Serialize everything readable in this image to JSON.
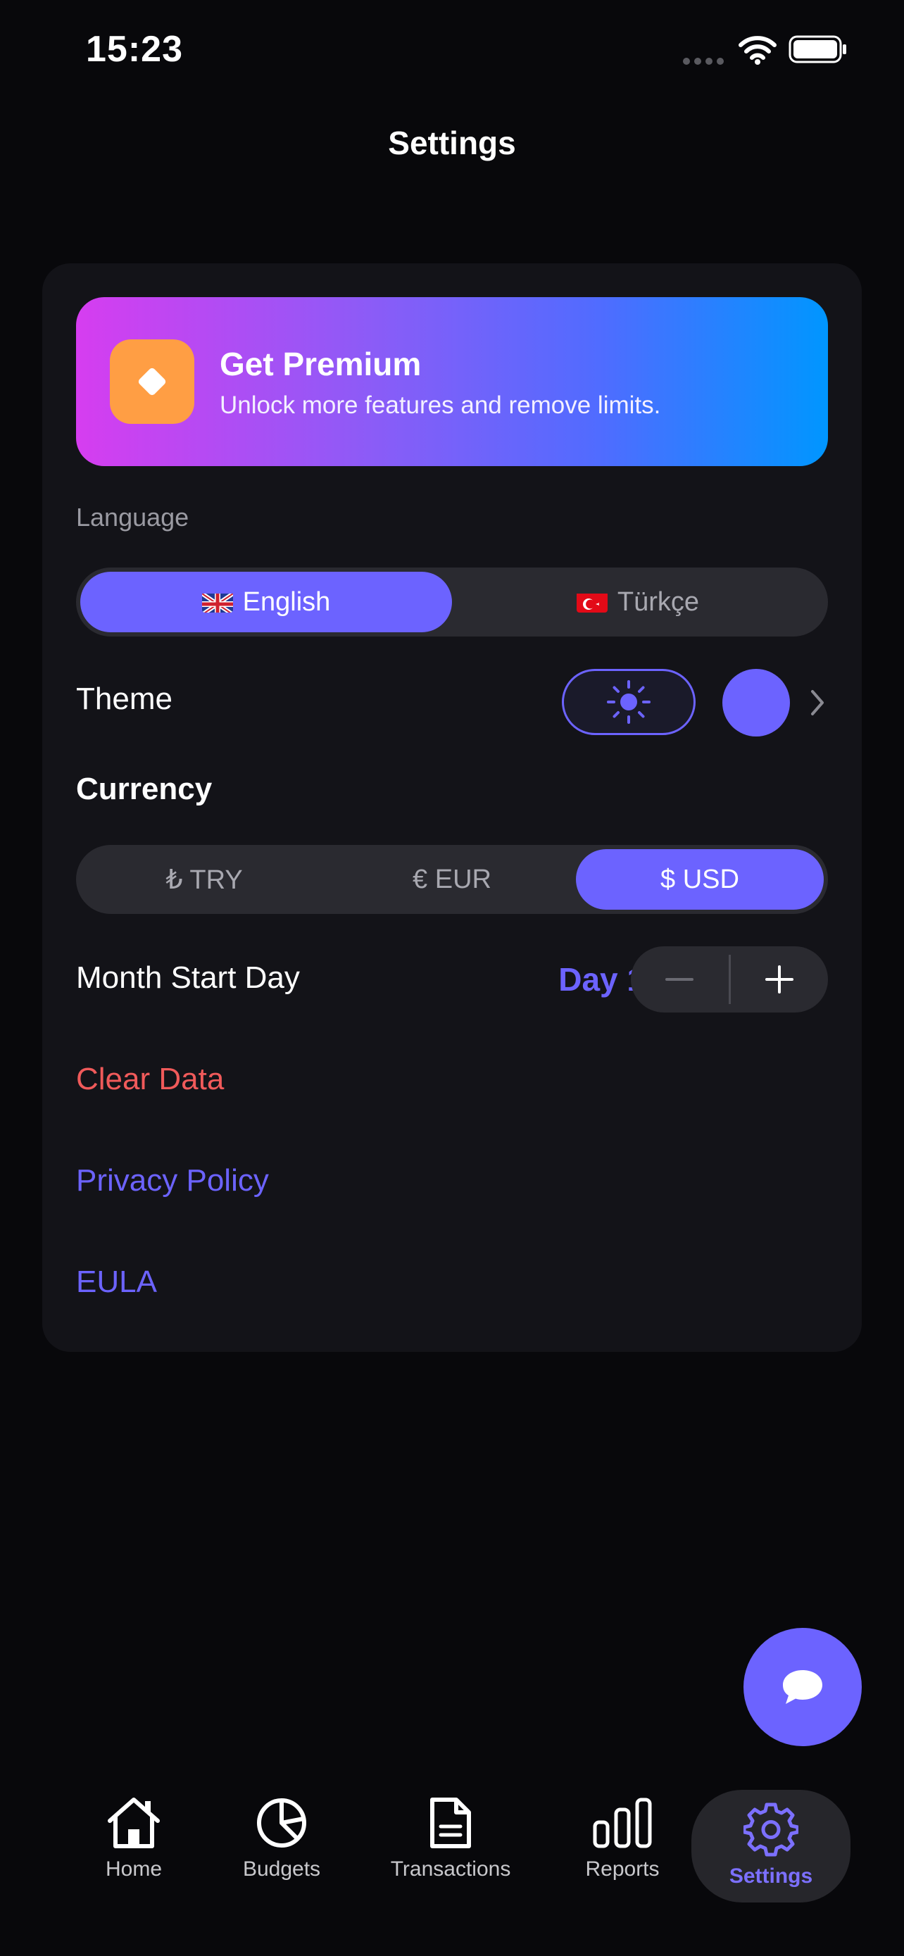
{
  "status_bar": {
    "time": "15:23"
  },
  "page_title": "Settings",
  "premium": {
    "title": "Get Premium",
    "subtitle": "Unlock more features and remove limits."
  },
  "language": {
    "label": "Language",
    "options": [
      {
        "label": "English",
        "flag": "uk-flag-icon",
        "selected": true
      },
      {
        "label": "Türkçe",
        "flag": "turkey-flag-icon",
        "selected": false
      }
    ]
  },
  "theme": {
    "label": "Theme",
    "mode": "light",
    "accent_color": "#6c63ff"
  },
  "currency": {
    "label": "Currency",
    "options": [
      {
        "label": "₺ TRY",
        "selected": false
      },
      {
        "label": "€ EUR",
        "selected": false
      },
      {
        "label": "$ USD",
        "selected": true
      }
    ]
  },
  "month_start": {
    "label": "Month Start Day",
    "value": "Day 1"
  },
  "links": {
    "clear_data": "Clear Data",
    "privacy_policy": "Privacy Policy",
    "eula": "EULA"
  },
  "tabs": [
    {
      "label": "Home",
      "icon": "home-icon",
      "active": false
    },
    {
      "label": "Budgets",
      "icon": "pie-chart-icon",
      "active": false
    },
    {
      "label": "Transactions",
      "icon": "document-icon",
      "active": false
    },
    {
      "label": "Reports",
      "icon": "bar-chart-icon",
      "active": false
    },
    {
      "label": "Settings",
      "icon": "gear-icon",
      "active": true
    }
  ],
  "colors": {
    "background": "#08080b",
    "card": "#131318",
    "accent": "#6c63ff",
    "danger": "#f05a5a",
    "premium_badge": "#ff9e44"
  }
}
